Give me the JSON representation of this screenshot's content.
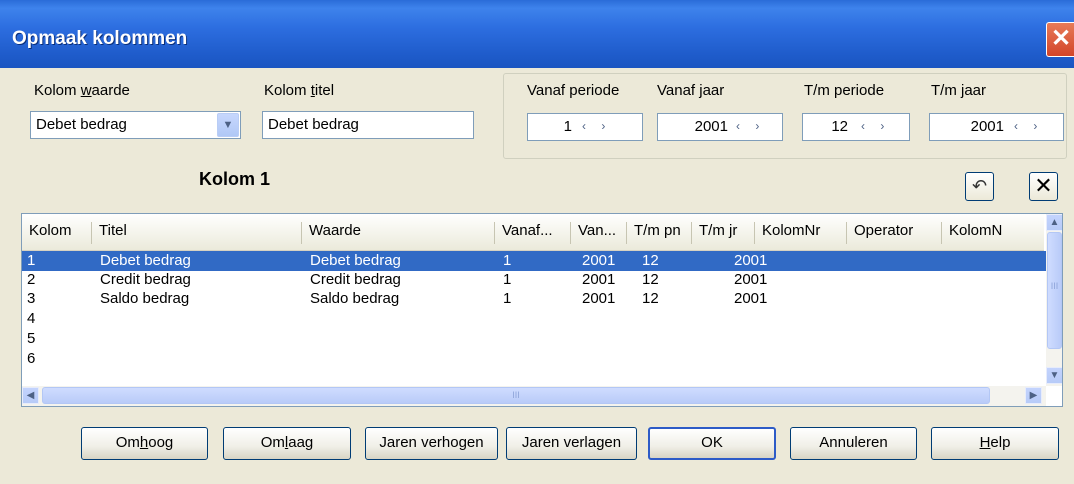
{
  "window": {
    "title": "Opmaak kolommen",
    "close_glyph": "✕"
  },
  "kolom_waarde": {
    "label_pre": "Kolom ",
    "label_u": "w",
    "label_post": "aarde",
    "value": "Debet bedrag"
  },
  "kolom_titel": {
    "label_pre": "Kolom ",
    "label_u": "t",
    "label_post": "itel",
    "value": "Debet bedrag"
  },
  "period": {
    "vanaf_periode": {
      "label": "Vanaf periode",
      "value": "1"
    },
    "vanaf_jaar": {
      "label": "Vanaf jaar",
      "value": "2001"
    },
    "tm_periode": {
      "label": "T/m periode",
      "value": "12"
    },
    "tm_jaar": {
      "label": "T/m jaar",
      "value": "2001"
    },
    "spin_glyph": "‹ ›"
  },
  "heading": "Kolom 1",
  "icons": {
    "undo": "↶",
    "delete": "✕"
  },
  "list": {
    "columns": [
      "Kolom",
      "Titel",
      "Waarde",
      "Vanaf...",
      "Van...",
      "T/m pn",
      "T/m jr",
      "KolomNr",
      "Operator",
      "KolomN"
    ],
    "rows": [
      {
        "kolom": "1",
        "titel": "Debet bedrag",
        "waarde": "Debet bedrag",
        "vanaf": "1",
        "van": "2001",
        "tmpn": "12",
        "tmjr": "2001"
      },
      {
        "kolom": "2",
        "titel": "Credit bedrag",
        "waarde": "Credit bedrag",
        "vanaf": "1",
        "van": "2001",
        "tmpn": "12",
        "tmjr": "2001"
      },
      {
        "kolom": "3",
        "titel": "Saldo bedrag",
        "waarde": "Saldo bedrag",
        "vanaf": "1",
        "van": "2001",
        "tmpn": "12",
        "tmjr": "2001"
      },
      {
        "kolom": "4",
        "titel": "",
        "waarde": "",
        "vanaf": "",
        "van": "",
        "tmpn": "",
        "tmjr": ""
      },
      {
        "kolom": "5",
        "titel": "",
        "waarde": "",
        "vanaf": "",
        "van": "",
        "tmpn": "",
        "tmjr": ""
      },
      {
        "kolom": "6",
        "titel": "",
        "waarde": "",
        "vanaf": "",
        "van": "",
        "tmpn": "",
        "tmjr": ""
      }
    ],
    "selected_index": 0,
    "scroll_glyphs": {
      "up": "▲",
      "down": "▼",
      "left": "◀",
      "right": "▶",
      "grip": "III"
    }
  },
  "buttons": {
    "omhoog": {
      "pre": "Om",
      "u": "h",
      "post": "oog"
    },
    "omlaag": {
      "pre": "Om",
      "u": "l",
      "post": "aag"
    },
    "jaren_verhogen": "Jaren verhogen",
    "jaren_verlagen": "Jaren verlagen",
    "ok": "OK",
    "annuleren": "Annuleren",
    "help": {
      "pre": "",
      "u": "H",
      "post": "elp"
    }
  }
}
